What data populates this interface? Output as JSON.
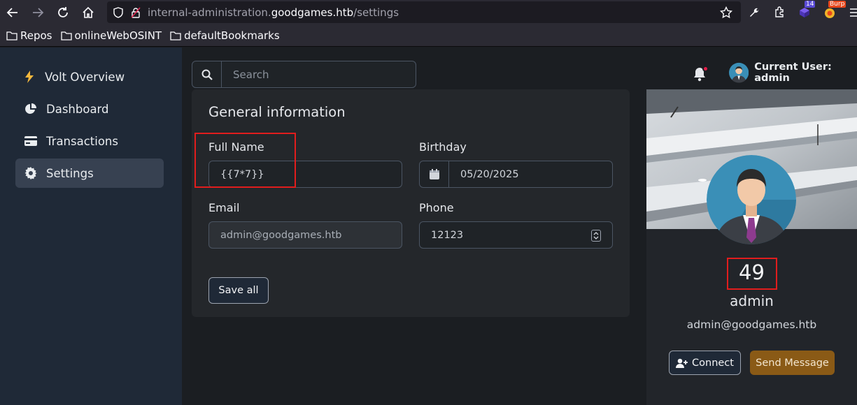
{
  "browser": {
    "url_prefix": "internal-administration.",
    "url_domain": "goodgames.htb",
    "url_path": "/settings",
    "extension_badge": "14",
    "burp_label": "Burp",
    "bookmarks": [
      "Repos",
      "onlineWebOSINT",
      "defaultBookmarks"
    ]
  },
  "sidebar": {
    "brand": "Volt Overview",
    "items": [
      {
        "label": "Dashboard",
        "icon": "pie-chart-icon"
      },
      {
        "label": "Transactions",
        "icon": "credit-card-icon"
      },
      {
        "label": "Settings",
        "icon": "gear-icon",
        "active": true
      }
    ]
  },
  "topbar": {
    "search_placeholder": "Search",
    "current_user": "Current User: admin"
  },
  "form": {
    "title": "General information",
    "full_name_label": "Full Name",
    "full_name_value": "{{7*7}}",
    "birthday_label": "Birthday",
    "birthday_value": "05/20/2025",
    "email_label": "Email",
    "email_value": "admin@goodgames.htb",
    "phone_label": "Phone",
    "phone_value": "12123",
    "save_label": "Save all"
  },
  "profile": {
    "display_value": "49",
    "username": "admin",
    "email": "admin@goodgames.htb",
    "connect_label": "Connect",
    "message_label": "Send Message"
  },
  "colors": {
    "highlight": "#e11d1d",
    "accent_button": "#8a5a16",
    "notification_dot": "#e11d48"
  }
}
